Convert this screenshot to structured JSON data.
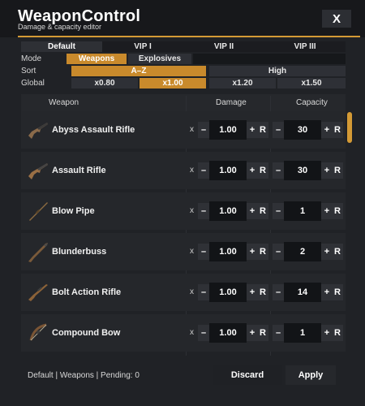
{
  "header": {
    "title": "WeaponControl",
    "subtitle": "Damage & capacity editor",
    "close_label": "X"
  },
  "tabs": [
    {
      "label": "Default",
      "active": true
    },
    {
      "label": "VIP I",
      "active": false
    },
    {
      "label": "VIP II",
      "active": false
    },
    {
      "label": "VIP III",
      "active": false
    }
  ],
  "mode": {
    "label": "Mode",
    "options": [
      "Weapons",
      "Explosives"
    ],
    "selected": "Weapons"
  },
  "sort": {
    "label": "Sort",
    "options": [
      "A–Z",
      "High"
    ],
    "selected": "A–Z"
  },
  "global": {
    "label": "Global",
    "options": [
      "x0.80",
      "x1.00",
      "x1.20",
      "x1.50"
    ],
    "selected": "x1.00"
  },
  "table": {
    "columns": {
      "weapon": "Weapon",
      "damage": "Damage",
      "capacity": "Capacity"
    },
    "row_controls": {
      "x_label": "x",
      "minus_label": "–",
      "plus_label": "+",
      "reset_label": "R"
    },
    "rows": [
      {
        "name": "Abyss Assault Rifle",
        "damage": "1.00",
        "capacity": "30",
        "icon": "assault-rifle-icon"
      },
      {
        "name": "Assault Rifle",
        "damage": "1.00",
        "capacity": "30",
        "icon": "assault-rifle-icon"
      },
      {
        "name": "Blow Pipe",
        "damage": "1.00",
        "capacity": "1",
        "icon": "blow-pipe-icon"
      },
      {
        "name": "Blunderbuss",
        "damage": "1.00",
        "capacity": "2",
        "icon": "blunderbuss-icon"
      },
      {
        "name": "Bolt Action Rifle",
        "damage": "1.00",
        "capacity": "14",
        "icon": "bolt-rifle-icon"
      },
      {
        "name": "Compound Bow",
        "damage": "1.00",
        "capacity": "1",
        "icon": "bow-icon"
      }
    ]
  },
  "footer": {
    "status": "Default | Weapons | Pending: 0",
    "discard_label": "Discard",
    "apply_label": "Apply"
  },
  "colors": {
    "accent": "#d49a35",
    "background": "#202226",
    "value_box": "#121417"
  }
}
